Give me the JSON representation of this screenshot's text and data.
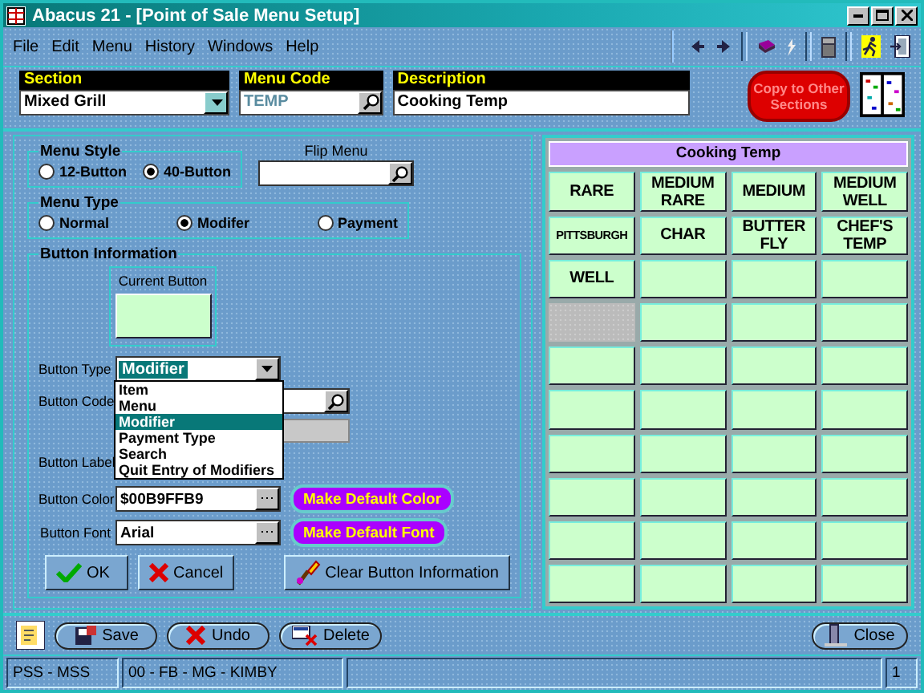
{
  "window": {
    "title": "Abacus 21 - [Point of Sale Menu Setup]"
  },
  "menu": [
    "File",
    "Edit",
    "Menu",
    "History",
    "Windows",
    "Help"
  ],
  "header": {
    "section": {
      "label": "Section",
      "value": "Mixed Grill"
    },
    "menu_code": {
      "label": "Menu Code",
      "value": "TEMP"
    },
    "description": {
      "label": "Description",
      "value": "Cooking Temp"
    },
    "copy_button": "Copy to Other Sections"
  },
  "menu_style": {
    "title": "Menu Style",
    "options": [
      {
        "label": "12-Button",
        "selected": false
      },
      {
        "label": "40-Button",
        "selected": true
      }
    ]
  },
  "flip_menu": {
    "label": "Flip Menu"
  },
  "menu_type": {
    "title": "Menu Type",
    "options": [
      {
        "label": "Normal",
        "selected": false
      },
      {
        "label": "Modifer",
        "selected": true
      },
      {
        "label": "Payment",
        "selected": false
      }
    ]
  },
  "button_info": {
    "title": "Button Information",
    "current_button": {
      "label": "Current Button"
    },
    "type": {
      "label": "Button Type",
      "value": "Modifier",
      "options": [
        {
          "label": "Item",
          "selected": false
        },
        {
          "label": "Menu",
          "selected": false
        },
        {
          "label": "Modifier",
          "selected": true
        },
        {
          "label": "Payment Type",
          "selected": false
        },
        {
          "label": "Search",
          "selected": false
        },
        {
          "label": "Quit Entry of Modifiers",
          "selected": false
        }
      ]
    },
    "code": {
      "label": "Button Code"
    },
    "button_label": {
      "label": "Button Label"
    },
    "color": {
      "label": "Button Color",
      "value": "$00B9FFB9",
      "default_button": "Make Default Color"
    },
    "font": {
      "label": "Button Font",
      "value": "Arial",
      "default_button": "Make Default Font"
    }
  },
  "actions": [
    {
      "kind": "ok",
      "label": "OK"
    },
    {
      "kind": "cancel",
      "label": "Cancel"
    },
    {
      "kind": "clear",
      "label": "Clear Button Information"
    }
  ],
  "grid": {
    "title": "Cooking Temp",
    "cells": [
      {
        "kind": "button",
        "label": "RARE"
      },
      {
        "kind": "button",
        "label": "MEDIUM RARE"
      },
      {
        "kind": "button",
        "label": "MEDIUM"
      },
      {
        "kind": "button",
        "label": "MEDIUM WELL"
      },
      {
        "kind": "button",
        "label": "PITTSBURGH"
      },
      {
        "kind": "button",
        "label": "CHAR"
      },
      {
        "kind": "button",
        "label": "BUTTER FLY"
      },
      {
        "kind": "button",
        "label": "CHEF'S TEMP"
      },
      {
        "kind": "button",
        "label": "WELL"
      },
      {
        "kind": "button"
      },
      {
        "kind": "button"
      },
      {
        "kind": "button"
      },
      {
        "kind": "empty"
      },
      {
        "kind": "button"
      },
      {
        "kind": "button"
      },
      {
        "kind": "button"
      },
      {
        "kind": "button"
      },
      {
        "kind": "button"
      },
      {
        "kind": "button"
      },
      {
        "kind": "button"
      },
      {
        "kind": "button"
      },
      {
        "kind": "button"
      },
      {
        "kind": "button"
      },
      {
        "kind": "button"
      },
      {
        "kind": "button"
      },
      {
        "kind": "button"
      },
      {
        "kind": "button"
      },
      {
        "kind": "button"
      },
      {
        "kind": "button"
      },
      {
        "kind": "button"
      },
      {
        "kind": "button"
      },
      {
        "kind": "button"
      },
      {
        "kind": "button"
      },
      {
        "kind": "button"
      },
      {
        "kind": "button"
      },
      {
        "kind": "button"
      },
      {
        "kind": "button"
      },
      {
        "kind": "button"
      },
      {
        "kind": "button"
      },
      {
        "kind": "button"
      }
    ]
  },
  "toolbar": [
    {
      "kind": "save",
      "label": "Save"
    },
    {
      "kind": "undo",
      "label": "Undo"
    },
    {
      "kind": "delete",
      "label": "Delete"
    },
    {
      "kind": "close",
      "label": "Close"
    }
  ],
  "status_bar": [
    "PSS - MSS",
    "00 - FB - MG - KIMBY",
    "1"
  ]
}
